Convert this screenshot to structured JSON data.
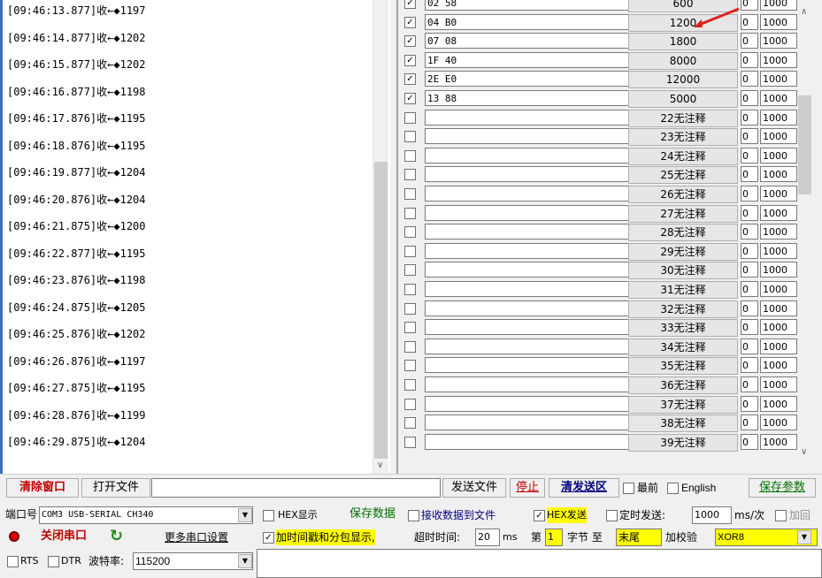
{
  "log": {
    "lines": [
      "[09:46:13.877]收←◆1197",
      "[09:46:14.877]收←◆1202",
      "[09:46:15.877]收←◆1202",
      "[09:46:16.877]收←◆1198",
      "[09:46:17.876]收←◆1195",
      "[09:46:18.876]收←◆1195",
      "[09:46:19.877]收←◆1204",
      "[09:46:20.876]收←◆1204",
      "[09:46:21.875]收←◆1200",
      "[09:46:22.877]收←◆1195",
      "[09:46:23.876]收←◆1198",
      "[09:46:24.875]收←◆1205",
      "[09:46:25.876]收←◆1202",
      "[09:46:26.876]收←◆1197",
      "[09:46:27.875]收←◆1195",
      "[09:46:28.876]收←◆1199",
      "[09:46:29.875]收←◆1204"
    ]
  },
  "send_list": {
    "rows": [
      {
        "checked": true,
        "hex": "02 58",
        "label": "600",
        "n1": "0",
        "n2": "1000"
      },
      {
        "checked": true,
        "hex": "04 B0",
        "label": "1200",
        "n1": "0",
        "n2": "1000"
      },
      {
        "checked": true,
        "hex": "07 08",
        "label": "1800",
        "n1": "0",
        "n2": "1000"
      },
      {
        "checked": true,
        "hex": "1F 40",
        "label": "8000",
        "n1": "0",
        "n2": "1000"
      },
      {
        "checked": true,
        "hex": "2E E0",
        "label": "12000",
        "n1": "0",
        "n2": "1000"
      },
      {
        "checked": true,
        "hex": "13 88",
        "label": "5000",
        "n1": "0",
        "n2": "1000"
      },
      {
        "checked": false,
        "hex": "",
        "label": "22无注释",
        "n1": "0",
        "n2": "1000"
      },
      {
        "checked": false,
        "hex": "",
        "label": "23无注释",
        "n1": "0",
        "n2": "1000"
      },
      {
        "checked": false,
        "hex": "",
        "label": "24无注释",
        "n1": "0",
        "n2": "1000"
      },
      {
        "checked": false,
        "hex": "",
        "label": "25无注释",
        "n1": "0",
        "n2": "1000"
      },
      {
        "checked": false,
        "hex": "",
        "label": "26无注释",
        "n1": "0",
        "n2": "1000"
      },
      {
        "checked": false,
        "hex": "",
        "label": "27无注释",
        "n1": "0",
        "n2": "1000"
      },
      {
        "checked": false,
        "hex": "",
        "label": "28无注释",
        "n1": "0",
        "n2": "1000"
      },
      {
        "checked": false,
        "hex": "",
        "label": "29无注释",
        "n1": "0",
        "n2": "1000"
      },
      {
        "checked": false,
        "hex": "",
        "label": "30无注释",
        "n1": "0",
        "n2": "1000"
      },
      {
        "checked": false,
        "hex": "",
        "label": "31无注释",
        "n1": "0",
        "n2": "1000"
      },
      {
        "checked": false,
        "hex": "",
        "label": "32无注释",
        "n1": "0",
        "n2": "1000"
      },
      {
        "checked": false,
        "hex": "",
        "label": "33无注释",
        "n1": "0",
        "n2": "1000"
      },
      {
        "checked": false,
        "hex": "",
        "label": "34无注释",
        "n1": "0",
        "n2": "1000"
      },
      {
        "checked": false,
        "hex": "",
        "label": "35无注释",
        "n1": "0",
        "n2": "1000"
      },
      {
        "checked": false,
        "hex": "",
        "label": "36无注释",
        "n1": "0",
        "n2": "1000"
      },
      {
        "checked": false,
        "hex": "",
        "label": "37无注释",
        "n1": "0",
        "n2": "1000"
      },
      {
        "checked": false,
        "hex": "",
        "label": "38无注释",
        "n1": "0",
        "n2": "1000"
      },
      {
        "checked": false,
        "hex": "",
        "label": "39无注释",
        "n1": "0",
        "n2": "1000"
      }
    ]
  },
  "toolbar": {
    "clear_window": "清除窗口",
    "open_file": "打开文件",
    "send_file": "发送文件",
    "stop": "停止",
    "clear_send": "清发送区",
    "topmost": "最前",
    "english": "English",
    "save_params": "保存参数"
  },
  "port": {
    "port_label": "端口号",
    "port_value": "COM3 USB-SERIAL CH340",
    "hex_display": "HEX显示",
    "save_data": "保存数据",
    "recv_to_file": "接收数据到文件",
    "hex_send": "HEX发送",
    "timed_send": "定时发送:",
    "timed_value": "1000",
    "timed_unit": "ms/次",
    "add_return": "加回",
    "close_port": "关闭串口",
    "more_settings": "更多串口设置",
    "timestamp": "加时间戳和分包显示,",
    "timeout_label": "超时时间:",
    "timeout_value": "20",
    "timeout_unit": "ms",
    "byte_prefix": "第",
    "byte_value": "1",
    "byte_to": "字节 至",
    "end_value": "末尾",
    "checksum_label": "加校验",
    "checksum_value": "XOR8",
    "rts": "RTS",
    "dtr": "DTR",
    "baud_label": "波特率:",
    "baud_value": "115200"
  },
  "colors": {
    "accent_red": "#c00000",
    "link_green": "#007000",
    "link_blue": "#000080",
    "highlight_yellow": "#ffff00"
  }
}
